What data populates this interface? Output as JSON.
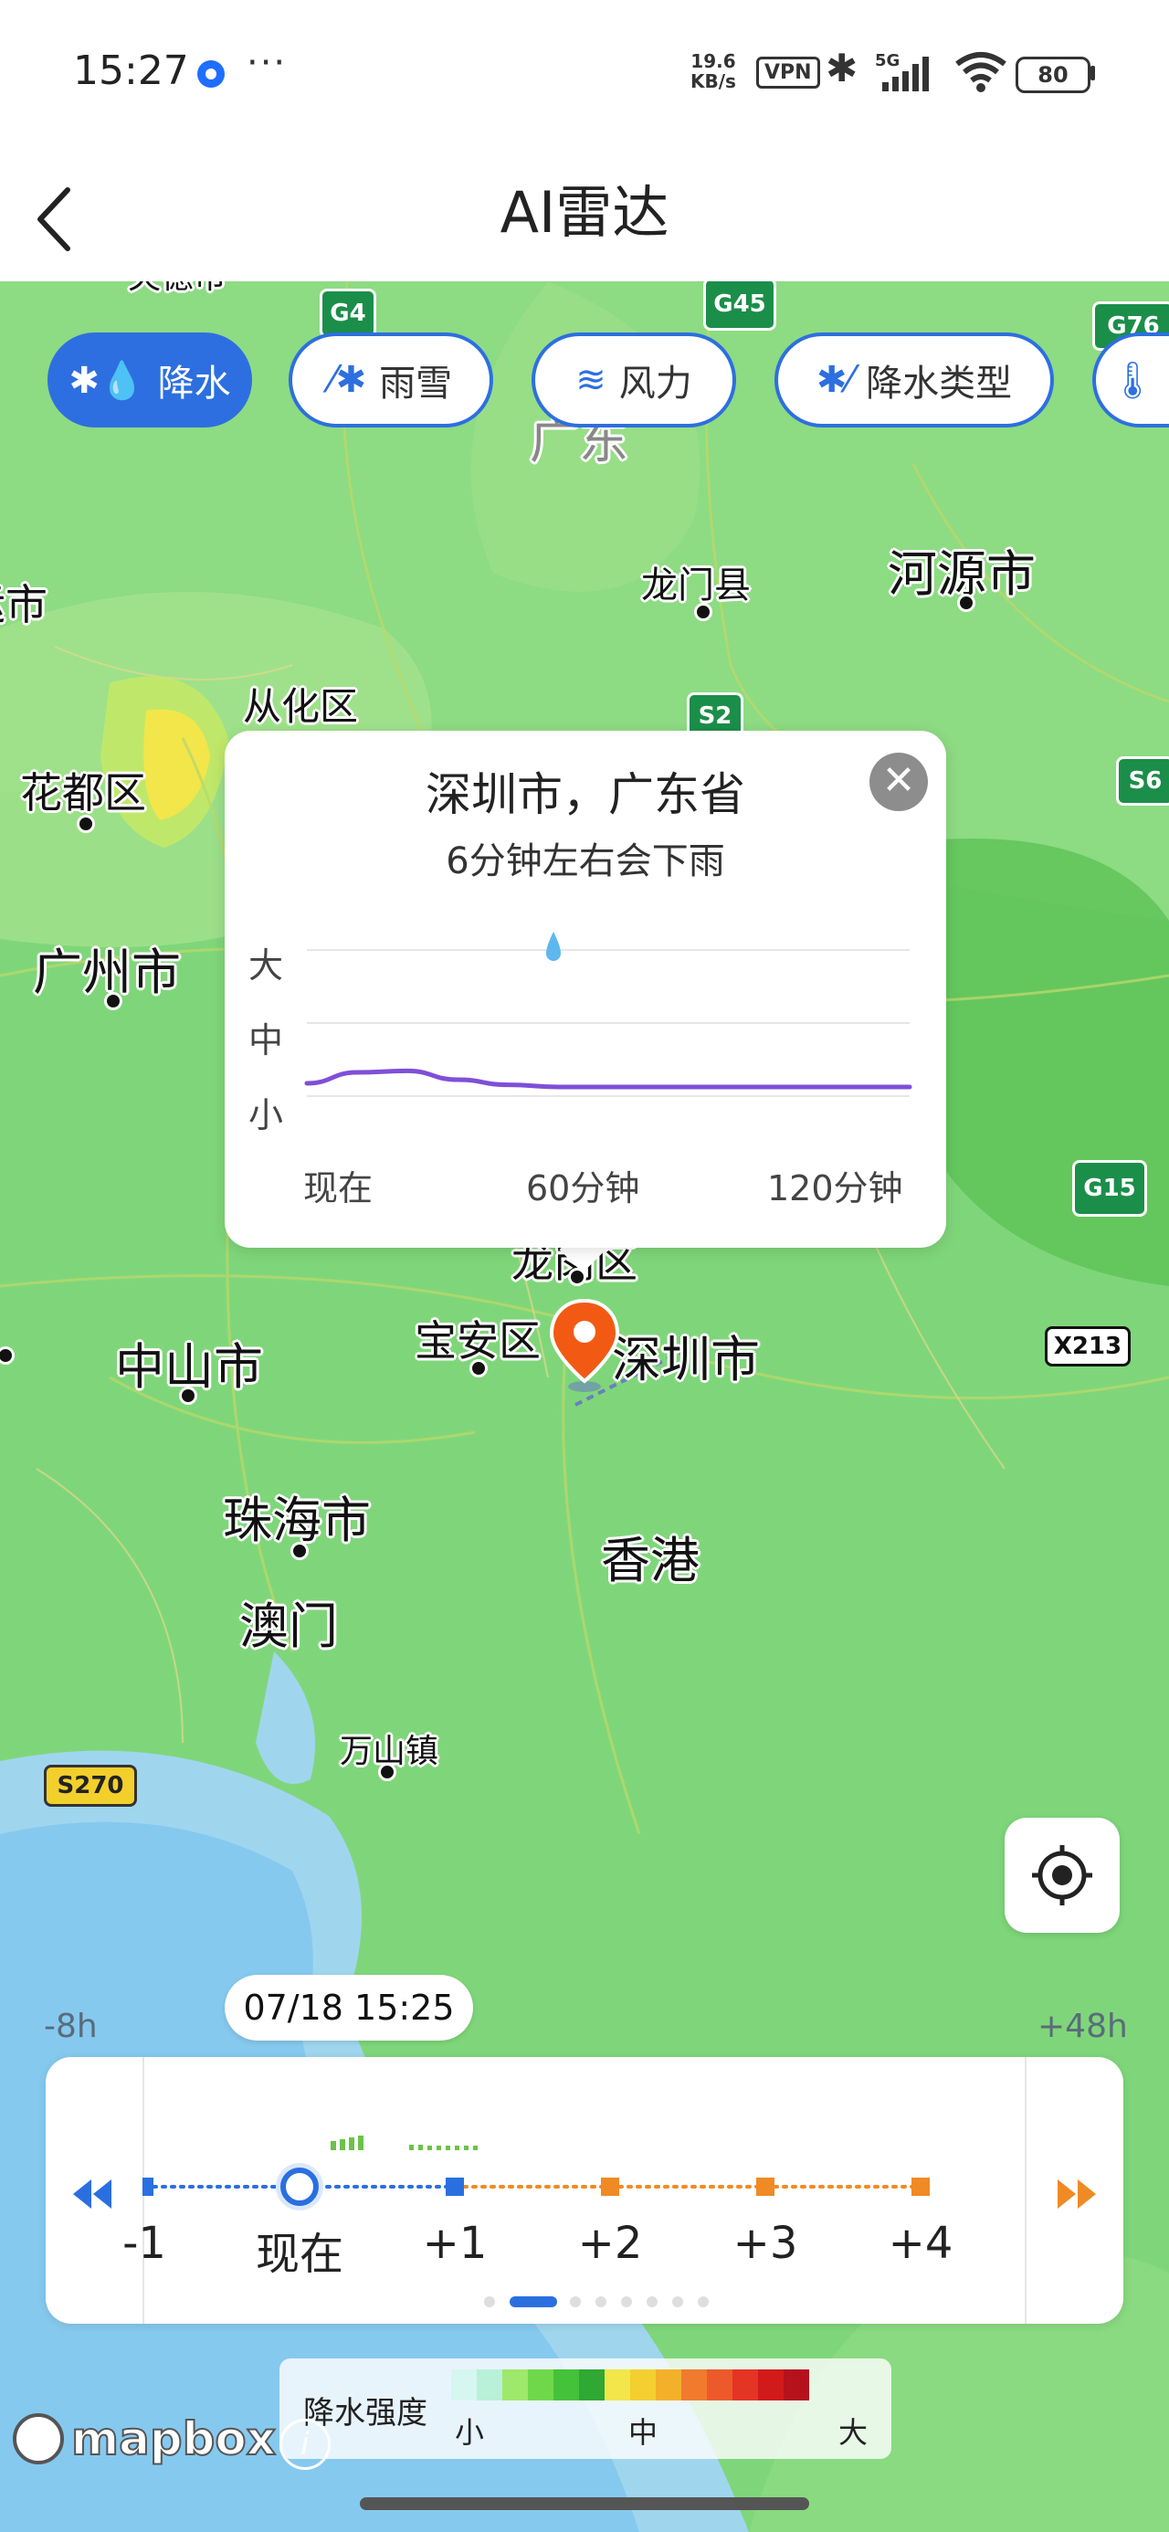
{
  "status_bar": {
    "time": "15:27",
    "more": "···",
    "net_speed_value": "19.6",
    "net_speed_unit": "KB/s",
    "vpn": "VPN",
    "network": "5G",
    "battery": "80"
  },
  "header": {
    "title": "AI雷达"
  },
  "layer_chips": [
    {
      "label": "降水",
      "icon": "rain-drops-icon",
      "active": true
    },
    {
      "label": "雨雪",
      "icon": "rain-snow-icon",
      "active": false
    },
    {
      "label": "风力",
      "icon": "wind-icon",
      "active": false
    },
    {
      "label": "降水类型",
      "icon": "precip-type-icon",
      "active": false
    },
    {
      "label": "",
      "icon": "thermometer-icon",
      "active": false
    }
  ],
  "map": {
    "labels": {
      "top_city_partial": "失德市",
      "guangdong_partial": "广东",
      "huizhou_partial": "运市",
      "longmen": "龙门县",
      "heyuan": "河源市",
      "conghua": "从化区",
      "huadu": "花都区",
      "guangzhou": "广州市",
      "longgang_partial": "龙岗区",
      "baoan": "宝安区",
      "shenzhen": "深圳市",
      "zhongshan": "中山市",
      "zhuhai": "珠海市",
      "hongkong": "香港",
      "macau": "澳门",
      "wanshan": "万山镇"
    },
    "shields": {
      "g4": "G4",
      "g45": "G45",
      "g6x": "G76",
      "s2": "S2",
      "s6": "S6",
      "g15": "G15",
      "x213": "X213",
      "s270": "S270"
    },
    "accent_color": "#2d6fe0",
    "marker_color": "#f25a14",
    "water_color": "#86c9ee",
    "land_color": "#7fd67a"
  },
  "popup": {
    "title": "深圳市，广东省",
    "subtitle": "6分钟左右会下雨",
    "y_labels": [
      "大",
      "中",
      "小"
    ],
    "x_labels": [
      "现在",
      "60分钟",
      "120分钟"
    ],
    "close_icon": "close-icon"
  },
  "chart_data": {
    "type": "line",
    "title": "",
    "xlabel": "",
    "ylabel": "",
    "x_ticks": [
      "现在",
      "60分钟",
      "120分钟"
    ],
    "y_ticks": [
      "小",
      "中",
      "大"
    ],
    "series": [
      {
        "color": "#7f4fd8",
        "x": [
          0,
          10,
          20,
          30,
          40,
          50,
          60,
          70,
          80,
          90,
          100,
          110,
          120
        ],
        "values": [
          0.05,
          0.2,
          0.22,
          0.1,
          0.03,
          0.0,
          0.0,
          0.0,
          0.0,
          0.0,
          0.0,
          0.0,
          0.0
        ]
      }
    ],
    "ylim": [
      0,
      2
    ],
    "grid": true
  },
  "timeline": {
    "selected_time": "07/18 15:25",
    "range_start": "-8h",
    "range_end": "+48h",
    "labels": [
      "-1",
      "现在",
      "+1",
      "+2",
      "+3",
      "+4"
    ],
    "selected_index": 1,
    "page_count": 8,
    "current_page": 1,
    "past_color": "#2a6fe0",
    "future_color": "#f08a24"
  },
  "legend": {
    "title": "降水强度",
    "low": "小",
    "mid": "中",
    "high": "大",
    "colors": [
      "#d6f6f0",
      "#b9f0d8",
      "#9ee86b",
      "#6fd84a",
      "#44c23a",
      "#2fa834",
      "#f2e64a",
      "#f4cf30",
      "#f3b02a",
      "#f07a2e",
      "#ec5a2b",
      "#e43424",
      "#d21a1a",
      "#b5121c"
    ]
  },
  "attribution": {
    "brand": "mapbox",
    "info": "i"
  }
}
